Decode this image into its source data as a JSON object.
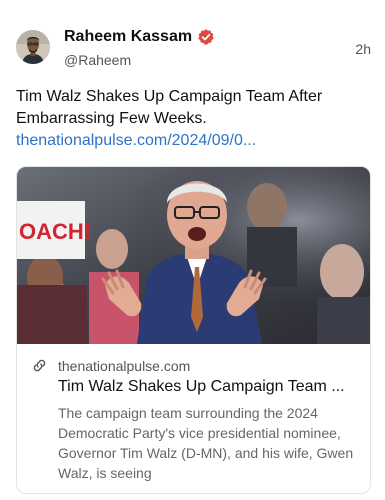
{
  "author": {
    "name": "Raheem Kassam",
    "handle": "@Raheem",
    "verified_color": "#e0493f"
  },
  "post": {
    "time": "2h",
    "text": "Tim Walz Shakes Up Campaign Team After Embarrassing Few Weeks.",
    "link": "thenationalpulse.com/2024/09/0..."
  },
  "card": {
    "domain": "thenationalpulse.com",
    "title": "Tim Walz Shakes Up Campaign Team ...",
    "description": "The campaign team surrounding the 2024 Democratic Party's vice presidential nominee, Governor Tim Walz (D-MN), and his wife, Gwen Walz, is seeing",
    "sign_text": "OACH!"
  },
  "icons": {
    "verified": "verified-badge-icon",
    "link": "link-chain-icon"
  },
  "colors": {
    "link": "#2e73c6",
    "text": "#111111",
    "muted": "#555555"
  }
}
